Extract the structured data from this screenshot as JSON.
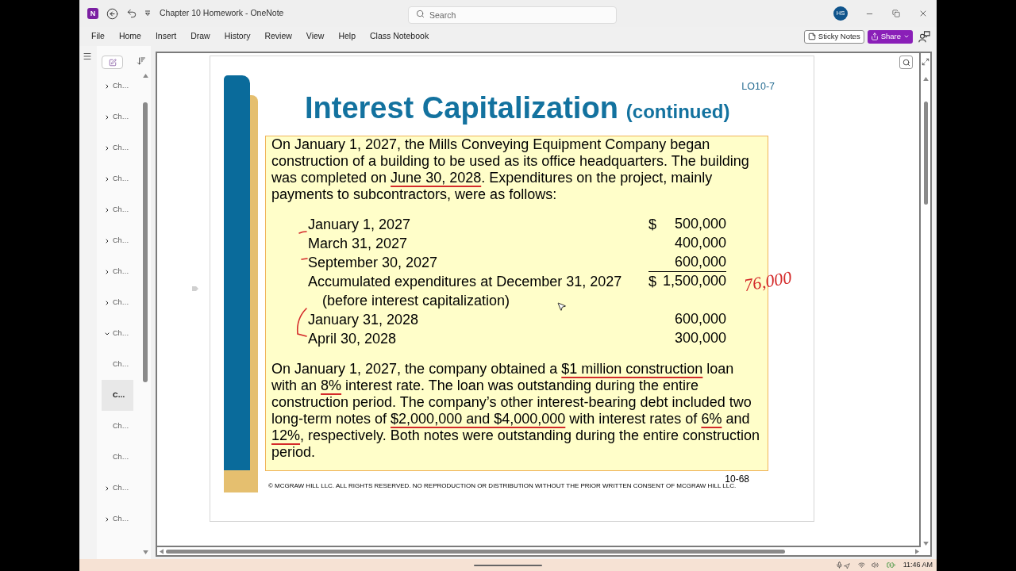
{
  "window": {
    "logo": "N",
    "title": "Chapter 10 Homework - OneNote",
    "search_placeholder": "Search",
    "initials": "HS"
  },
  "ribbon_tabs": [
    "File",
    "Home",
    "Insert",
    "Draw",
    "History",
    "Review",
    "View",
    "Help",
    "Class Notebook"
  ],
  "ribbon_actions": [
    {
      "kind": "sticky_notes",
      "label": "Sticky Notes"
    },
    {
      "kind": "share",
      "label": "Share"
    }
  ],
  "pages": [
    {
      "label": "Ch…",
      "expanded": false,
      "selected": false
    },
    {
      "label": "Ch…",
      "expanded": false,
      "selected": false
    },
    {
      "label": "Ch…",
      "expanded": false,
      "selected": false
    },
    {
      "label": "Ch…",
      "expanded": false,
      "selected": false
    },
    {
      "label": "Ch…",
      "expanded": false,
      "selected": false
    },
    {
      "label": "Ch…",
      "expanded": false,
      "selected": false
    },
    {
      "label": "Ch…",
      "expanded": false,
      "selected": false
    },
    {
      "label": "Ch…",
      "expanded": false,
      "selected": false
    },
    {
      "label": "Ch…",
      "expanded": true,
      "selected": false,
      "children": [
        {
          "label": "Ch…",
          "selected": false
        },
        {
          "label": "C…",
          "selected": true
        },
        {
          "label": "Ch…",
          "selected": false
        },
        {
          "label": "Ch…",
          "selected": false
        }
      ]
    },
    {
      "label": "Ch…",
      "expanded": false,
      "selected": false
    },
    {
      "label": "Ch…",
      "expanded": false,
      "selected": false
    }
  ],
  "slide": {
    "tag": "LO10-7",
    "title": "Interest Capitalization",
    "subtitle": "(continued)",
    "intro": [
      {
        "text": "On January 1, 2027, the Mills Conveying Equipment Company began\nconstruction of a building to be used as its office headquarters. The building\nwas completed on ",
        "ink_underline": false
      },
      {
        "text": "June 30, 2028",
        "ink_underline": true
      },
      {
        "text": ". Expenditures on the project, mainly\npayments to subcontractors, were as follows:",
        "ink_underline": false
      }
    ],
    "expenditures": [
      {
        "label": "January 1, 2027",
        "currency": "$",
        "amount": "500,000",
        "rule_below": false
      },
      {
        "label": "March 31, 2027",
        "amount": "400,000",
        "rule_below": false
      },
      {
        "label": "September 30, 2027",
        "amount": "600,000",
        "rule_below": true
      },
      {
        "label": "Accumulated expenditures at December 31, 2027",
        "note": "(before interest capitalization)",
        "currency": "$",
        "amount": "1,500,000",
        "rule_below": false
      },
      {
        "label": "January 31, 2028",
        "amount": "600,000",
        "rule_below": false
      },
      {
        "label": "April 30, 2028",
        "amount": "300,000",
        "rule_below": false
      }
    ],
    "loan_text": [
      {
        "text": "On January 1, 2027, the company obtained a ",
        "ink_underline": false
      },
      {
        "text": "$1 million construction",
        "ink_underline": true
      },
      {
        "text": " loan\nwith an ",
        "ink_underline": false
      },
      {
        "text": "8%",
        "ink_underline": true
      },
      {
        "text": " interest rate. The loan was outstanding during the entire\nconstruction period. The company’s other interest-bearing debt included two\nlong-term notes of ",
        "ink_underline": false
      },
      {
        "text": "$2,000,000 and $4,000,000",
        "ink_underline": true
      },
      {
        "text": " with interest rates of ",
        "ink_underline": false
      },
      {
        "text": "6%",
        "ink_underline": true
      },
      {
        "text": " and\n",
        "ink_underline": false
      },
      {
        "text": "12%",
        "ink_underline": true
      },
      {
        "text": ", respectively. Both notes were outstanding during the entire construction\nperiod.",
        "ink_underline": false
      }
    ],
    "page_number": "10-68",
    "copyright": "© MCGRAW HILL LLC. ALL RIGHTS RESERVED. NO REPRODUCTION OR DISTRIBUTION WITHOUT THE PRIOR WRITTEN CONSENT OF MCGRAW HILL LLC."
  },
  "ink_note": "76,000",
  "taskbar": {
    "time": "11:46 AM"
  }
}
